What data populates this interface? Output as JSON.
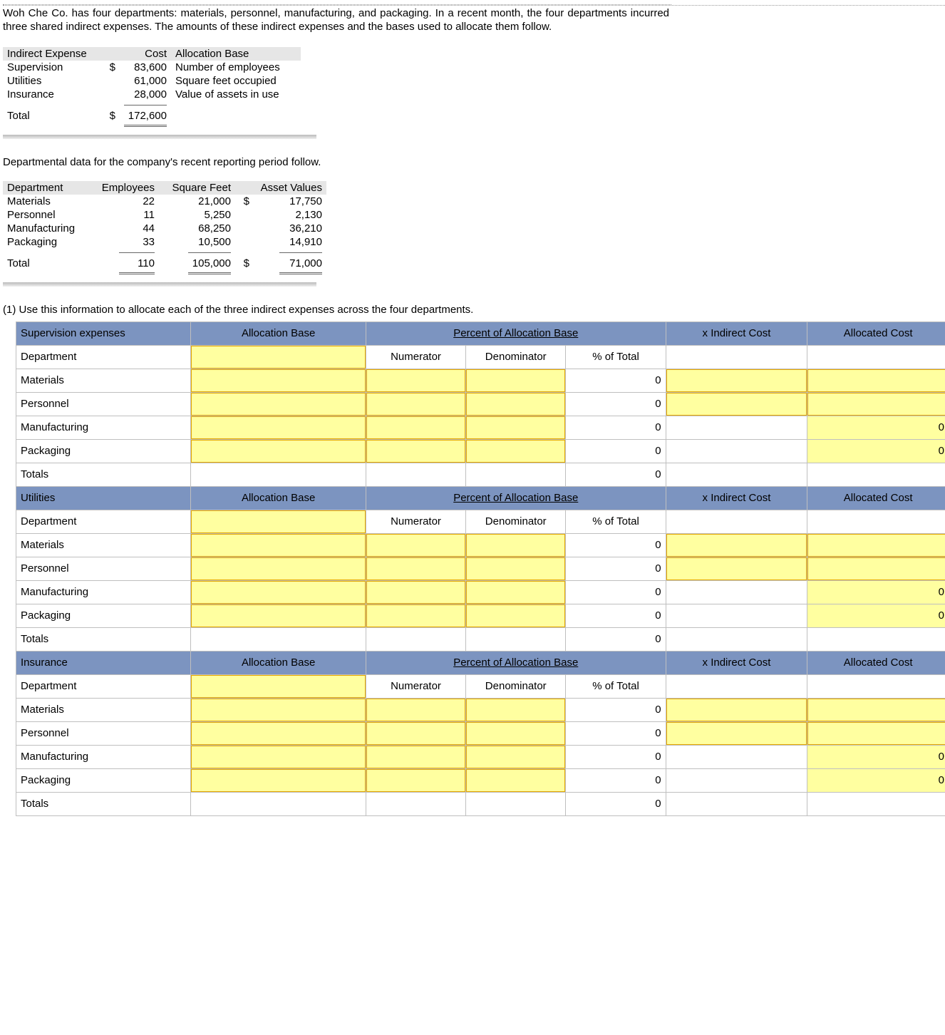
{
  "intro": "Woh Che Co. has four departments: materials, personnel, manufacturing, and packaging. In a recent month, the four departments incurred three shared indirect expenses. The amounts of these indirect expenses and the bases used to allocate them follow.",
  "expenseTable": {
    "headers": [
      "Indirect Expense",
      "Cost",
      "Allocation Base"
    ],
    "rows": [
      {
        "name": "Supervision",
        "cur": "$",
        "cost": "83,600",
        "base": "Number of employees"
      },
      {
        "name": "Utilities",
        "cur": "",
        "cost": "61,000",
        "base": "Square feet occupied"
      },
      {
        "name": "Insurance",
        "cur": "",
        "cost": "28,000",
        "base": "Value of assets in use"
      }
    ],
    "totalLabel": "Total",
    "totalCur": "$",
    "totalCost": "172,600"
  },
  "deptIntro": "Departmental data for the company's recent reporting period follow.",
  "deptTable": {
    "headers": [
      "Department",
      "Employees",
      "Square Feet",
      "Asset Values"
    ],
    "rows": [
      {
        "d": "Materials",
        "e": "22",
        "s": "21,000",
        "ac": "$",
        "a": "17,750"
      },
      {
        "d": "Personnel",
        "e": "11",
        "s": "5,250",
        "ac": "",
        "a": "2,130"
      },
      {
        "d": "Manufacturing",
        "e": "44",
        "s": "68,250",
        "ac": "",
        "a": "36,210"
      },
      {
        "d": "Packaging",
        "e": "33",
        "s": "10,500",
        "ac": "",
        "a": "14,910"
      }
    ],
    "totalLabel": "Total",
    "te": "110",
    "ts": "105,000",
    "tac": "$",
    "ta": "71,000"
  },
  "q1": "(1) Use this information to allocate each of the three indirect expenses across the four departments.",
  "allocHeaders": {
    "allocBase": "Allocation Base",
    "pctAlloc": "Percent of Allocation Base",
    "xCost": "x Indirect Cost",
    "allocCost": "Allocated Cost",
    "dept": "Department",
    "num": "Numerator",
    "den": "Denominator",
    "pct": "% of Total",
    "totals": "Totals"
  },
  "sections": [
    {
      "title": "Supervision expenses",
      "rows": [
        "Materials",
        "Personnel",
        "Manufacturing",
        "Packaging"
      ]
    },
    {
      "title": "Utilities",
      "rows": [
        "Materials",
        "Personnel",
        "Manufacturing",
        "Packaging"
      ]
    },
    {
      "title": "Insurance",
      "rows": [
        "Materials",
        "Personnel",
        "Manufacturing",
        "Packaging"
      ]
    }
  ],
  "zero": "0"
}
